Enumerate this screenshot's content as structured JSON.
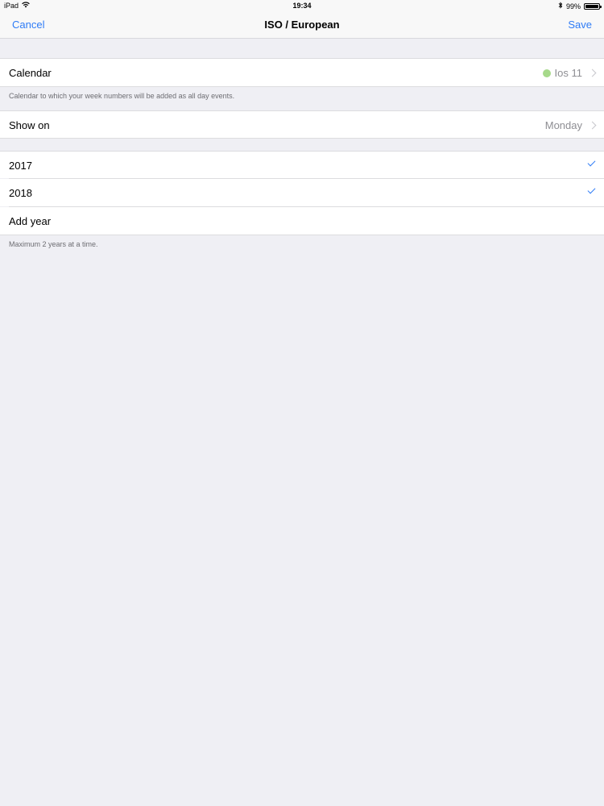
{
  "status_bar": {
    "device": "iPad",
    "time": "19:34",
    "battery": "99%",
    "battery_level": 0.99,
    "wifi_icon": "wifi-icon",
    "bluetooth_icon": "bluetooth-icon"
  },
  "nav": {
    "cancel": "Cancel",
    "title": "ISO / European",
    "save": "Save"
  },
  "calendar_row": {
    "label": "Calendar",
    "value": "Ios 11",
    "dot_color": "#a6d98a"
  },
  "calendar_footer": "Calendar to which your week numbers will be added as all day events.",
  "show_on_row": {
    "label": "Show on",
    "value": "Monday"
  },
  "years": [
    {
      "label": "2017",
      "checked": true
    },
    {
      "label": "2018",
      "checked": true
    }
  ],
  "add_year": "Add year",
  "years_footer": "Maximum 2 years at a time.",
  "colors": {
    "accent": "#2f7cf6",
    "background": "#efeff4"
  }
}
